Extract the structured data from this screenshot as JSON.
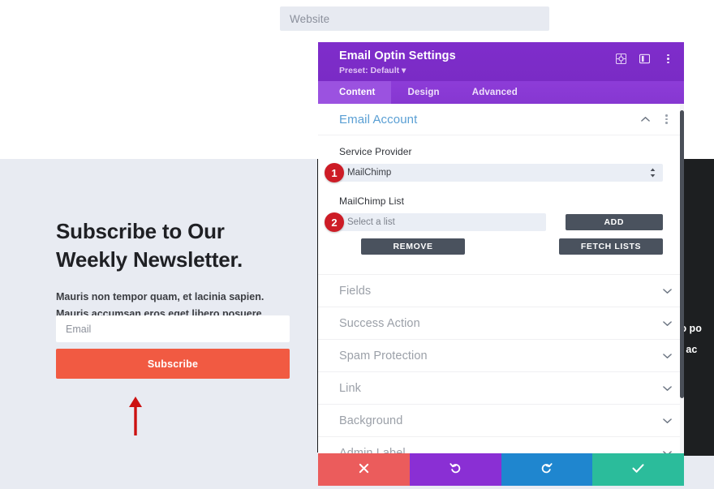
{
  "website_page": {
    "top_field_placeholder": "Website",
    "newsletter": {
      "heading": "Subscribe to Our Weekly Newsletter.",
      "body": "Mauris non tempor quam, et lacinia sapien. Mauris accumsan eros eget libero posuere vulputate.",
      "email_placeholder": "Email",
      "subscribe_label": "Subscribe"
    },
    "dark_column": {
      "line1": "bero po",
      "line2": "uris ac"
    },
    "colors": {
      "section_bg": "#e8ebf2",
      "subscribe_button": "#f15a42",
      "dark_section": "#1d1f21",
      "annotation_arrow": "#cc1111"
    }
  },
  "settings_modal": {
    "title": "Email Optin Settings",
    "preset": "Preset: Default ",
    "header_icons": [
      {
        "name": "target-icon"
      },
      {
        "name": "layout-panel-icon"
      },
      {
        "name": "more-vertical-icon"
      }
    ],
    "tabs": [
      {
        "label": "Content",
        "active": true
      },
      {
        "label": "Design",
        "active": false
      },
      {
        "label": "Advanced",
        "active": false
      }
    ],
    "email_account": {
      "title": "Email Account",
      "service_provider": {
        "label": "Service Provider",
        "value": "MailChimp",
        "badge": "1"
      },
      "mailchimp_list": {
        "label": "MailChimp List",
        "value": "Select a list",
        "badge": "2"
      },
      "buttons": {
        "add": "ADD",
        "remove": "REMOVE",
        "fetch_lists": "FETCH LISTS"
      }
    },
    "sections": [
      {
        "label": "Fields"
      },
      {
        "label": "Success Action"
      },
      {
        "label": "Spam Protection"
      },
      {
        "label": "Link"
      },
      {
        "label": "Background"
      },
      {
        "label": "Admin Label"
      }
    ],
    "footer_buttons": [
      {
        "name": "cancel",
        "icon": "close-icon",
        "color": "#eb5c5c"
      },
      {
        "name": "undo",
        "icon": "undo-icon",
        "color": "#8a2fd4"
      },
      {
        "name": "redo",
        "icon": "redo-icon",
        "color": "#1f86cf"
      },
      {
        "name": "save",
        "icon": "check-icon",
        "color": "#2bbc9b"
      }
    ],
    "colors": {
      "header": "#7b2fc4",
      "tabbar": "#8a3ad4",
      "active_tab": "#9b52e0",
      "section_title": "#5a9fd4",
      "dark_button": "#4a525e",
      "badge": "#cd1c26"
    }
  }
}
